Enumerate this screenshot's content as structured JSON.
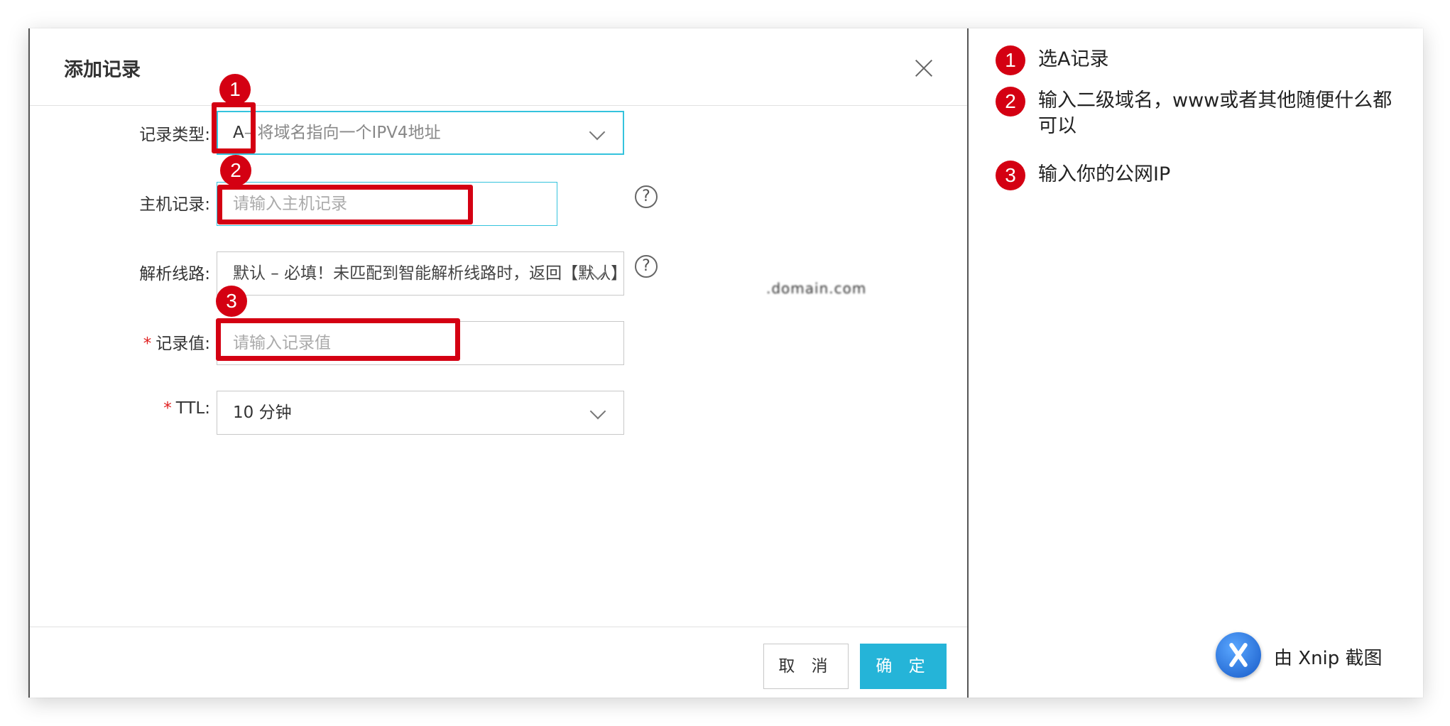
{
  "dialog": {
    "title": "添加记录",
    "fields": {
      "record_type": {
        "label": "记录类型:",
        "value_prefix": "A",
        "value_desc": "– 将域名指向一个IPV4地址"
      },
      "host": {
        "label": "主机记录:",
        "placeholder": "请输入主机记录",
        "domain_suffix": ".domain.com"
      },
      "line": {
        "label": "解析线路:",
        "value": "默认 – 必填！未匹配到智能解析线路时，返回【默认】线路..."
      },
      "record_value": {
        "required_mark": "*",
        "label": "记录值:",
        "placeholder": "请输入记录值"
      },
      "ttl": {
        "required_mark": "*",
        "label": "TTL:",
        "value": "10 分钟"
      }
    },
    "buttons": {
      "cancel": "取 消",
      "ok": "确 定"
    }
  },
  "annotations": {
    "badges": [
      "1",
      "2",
      "3"
    ],
    "color": "#d40012"
  },
  "notes": [
    {
      "num": "1",
      "text": "选A记录"
    },
    {
      "num": "2",
      "text": "输入二级域名，www或者其他随便什么都可以"
    },
    {
      "num": "3",
      "text": "输入你的公网IP"
    }
  ],
  "watermark": {
    "text": "由 Xnip 截图"
  },
  "colors": {
    "accent": "#25b4d8",
    "focus_border": "#35c3dd",
    "annotation_red": "#d40012"
  }
}
